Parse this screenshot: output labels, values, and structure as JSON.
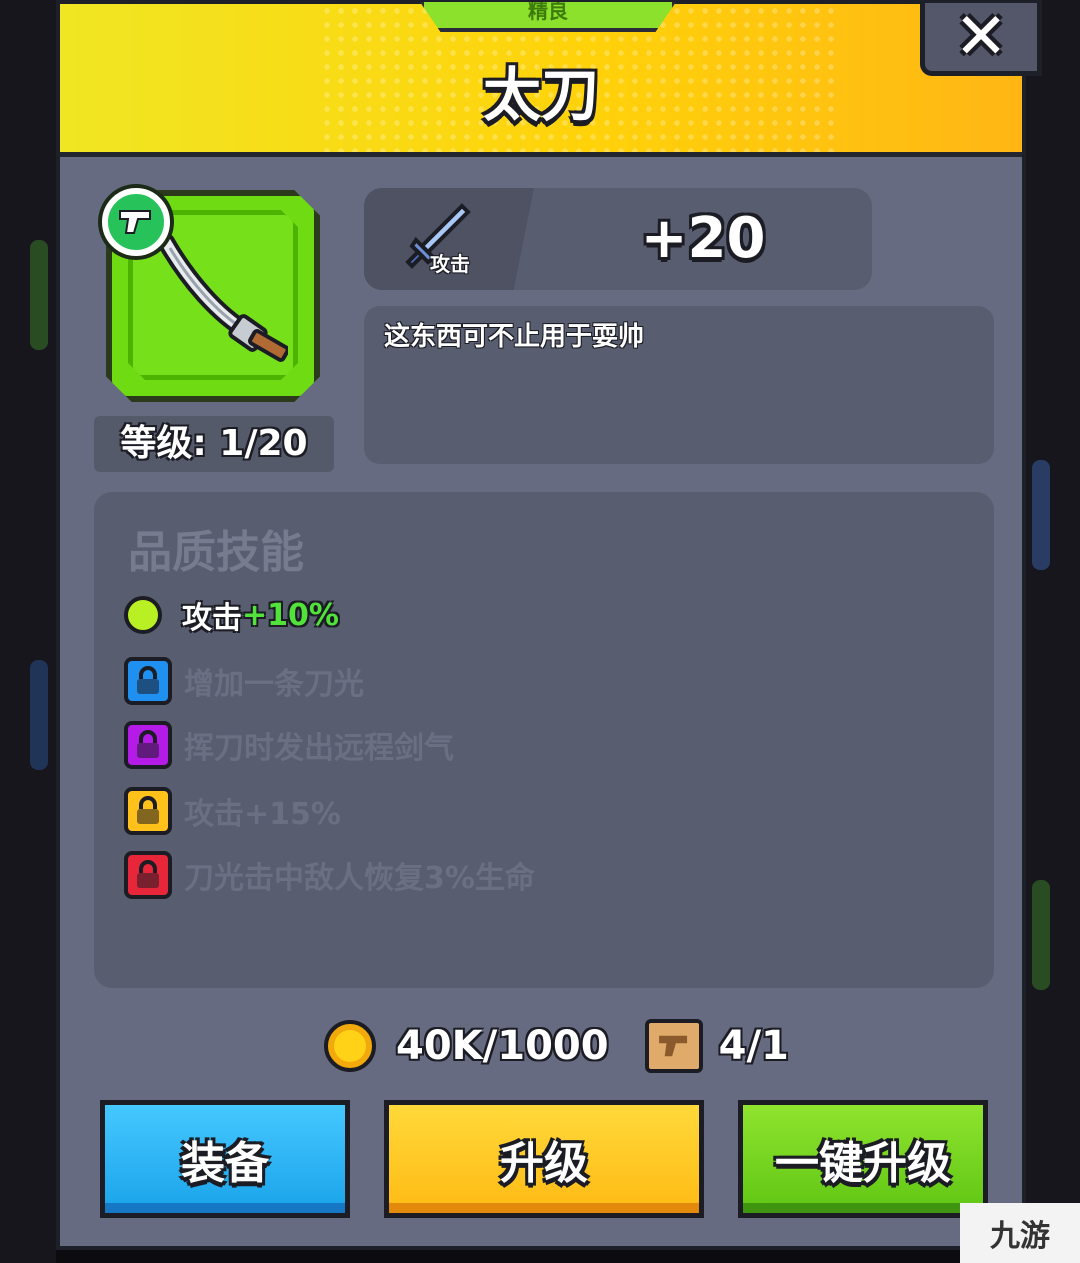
{
  "header": {
    "rarity_label": "精良",
    "title": "太刀",
    "close_icon": "close-icon"
  },
  "item": {
    "icon": "katana-icon",
    "type_badge_icon": "pistol-icon",
    "level_label": "等级: 1/20"
  },
  "stat": {
    "icon": "sword-icon",
    "label": "攻击",
    "value": "+20"
  },
  "description": "这东西可不止用于耍帅",
  "skills": {
    "title": "品质技能",
    "active": {
      "text": "攻击",
      "bonus": "+10%",
      "color": "#b9f024"
    },
    "locked": [
      {
        "text": "增加一条刀光",
        "color": "#1f8ff0"
      },
      {
        "text": "挥刀时发出远程剑气",
        "color": "#b51be6"
      },
      {
        "text": "攻击+15%",
        "color": "#ffc11a"
      },
      {
        "text": "刀光击中敌人恢复3%生命",
        "color": "#e8263a"
      }
    ]
  },
  "cost": {
    "coin_icon": "coin-icon",
    "gold": "40K/1000",
    "scroll_icon": "scroll-icon",
    "scrolls": "4/1"
  },
  "buttons": {
    "equip": "装备",
    "upgrade": "升级",
    "one_click_upgrade": "一键升级"
  },
  "colors": {
    "panel_bg": "#666b81",
    "header_yellow": "#ffd20a",
    "rarity_green": "#8be12c",
    "equip_blue": "#1aa3ea",
    "upgrade_yellow": "#ffba14",
    "oneclick_green": "#5fc614"
  },
  "corner_logo": "九游"
}
